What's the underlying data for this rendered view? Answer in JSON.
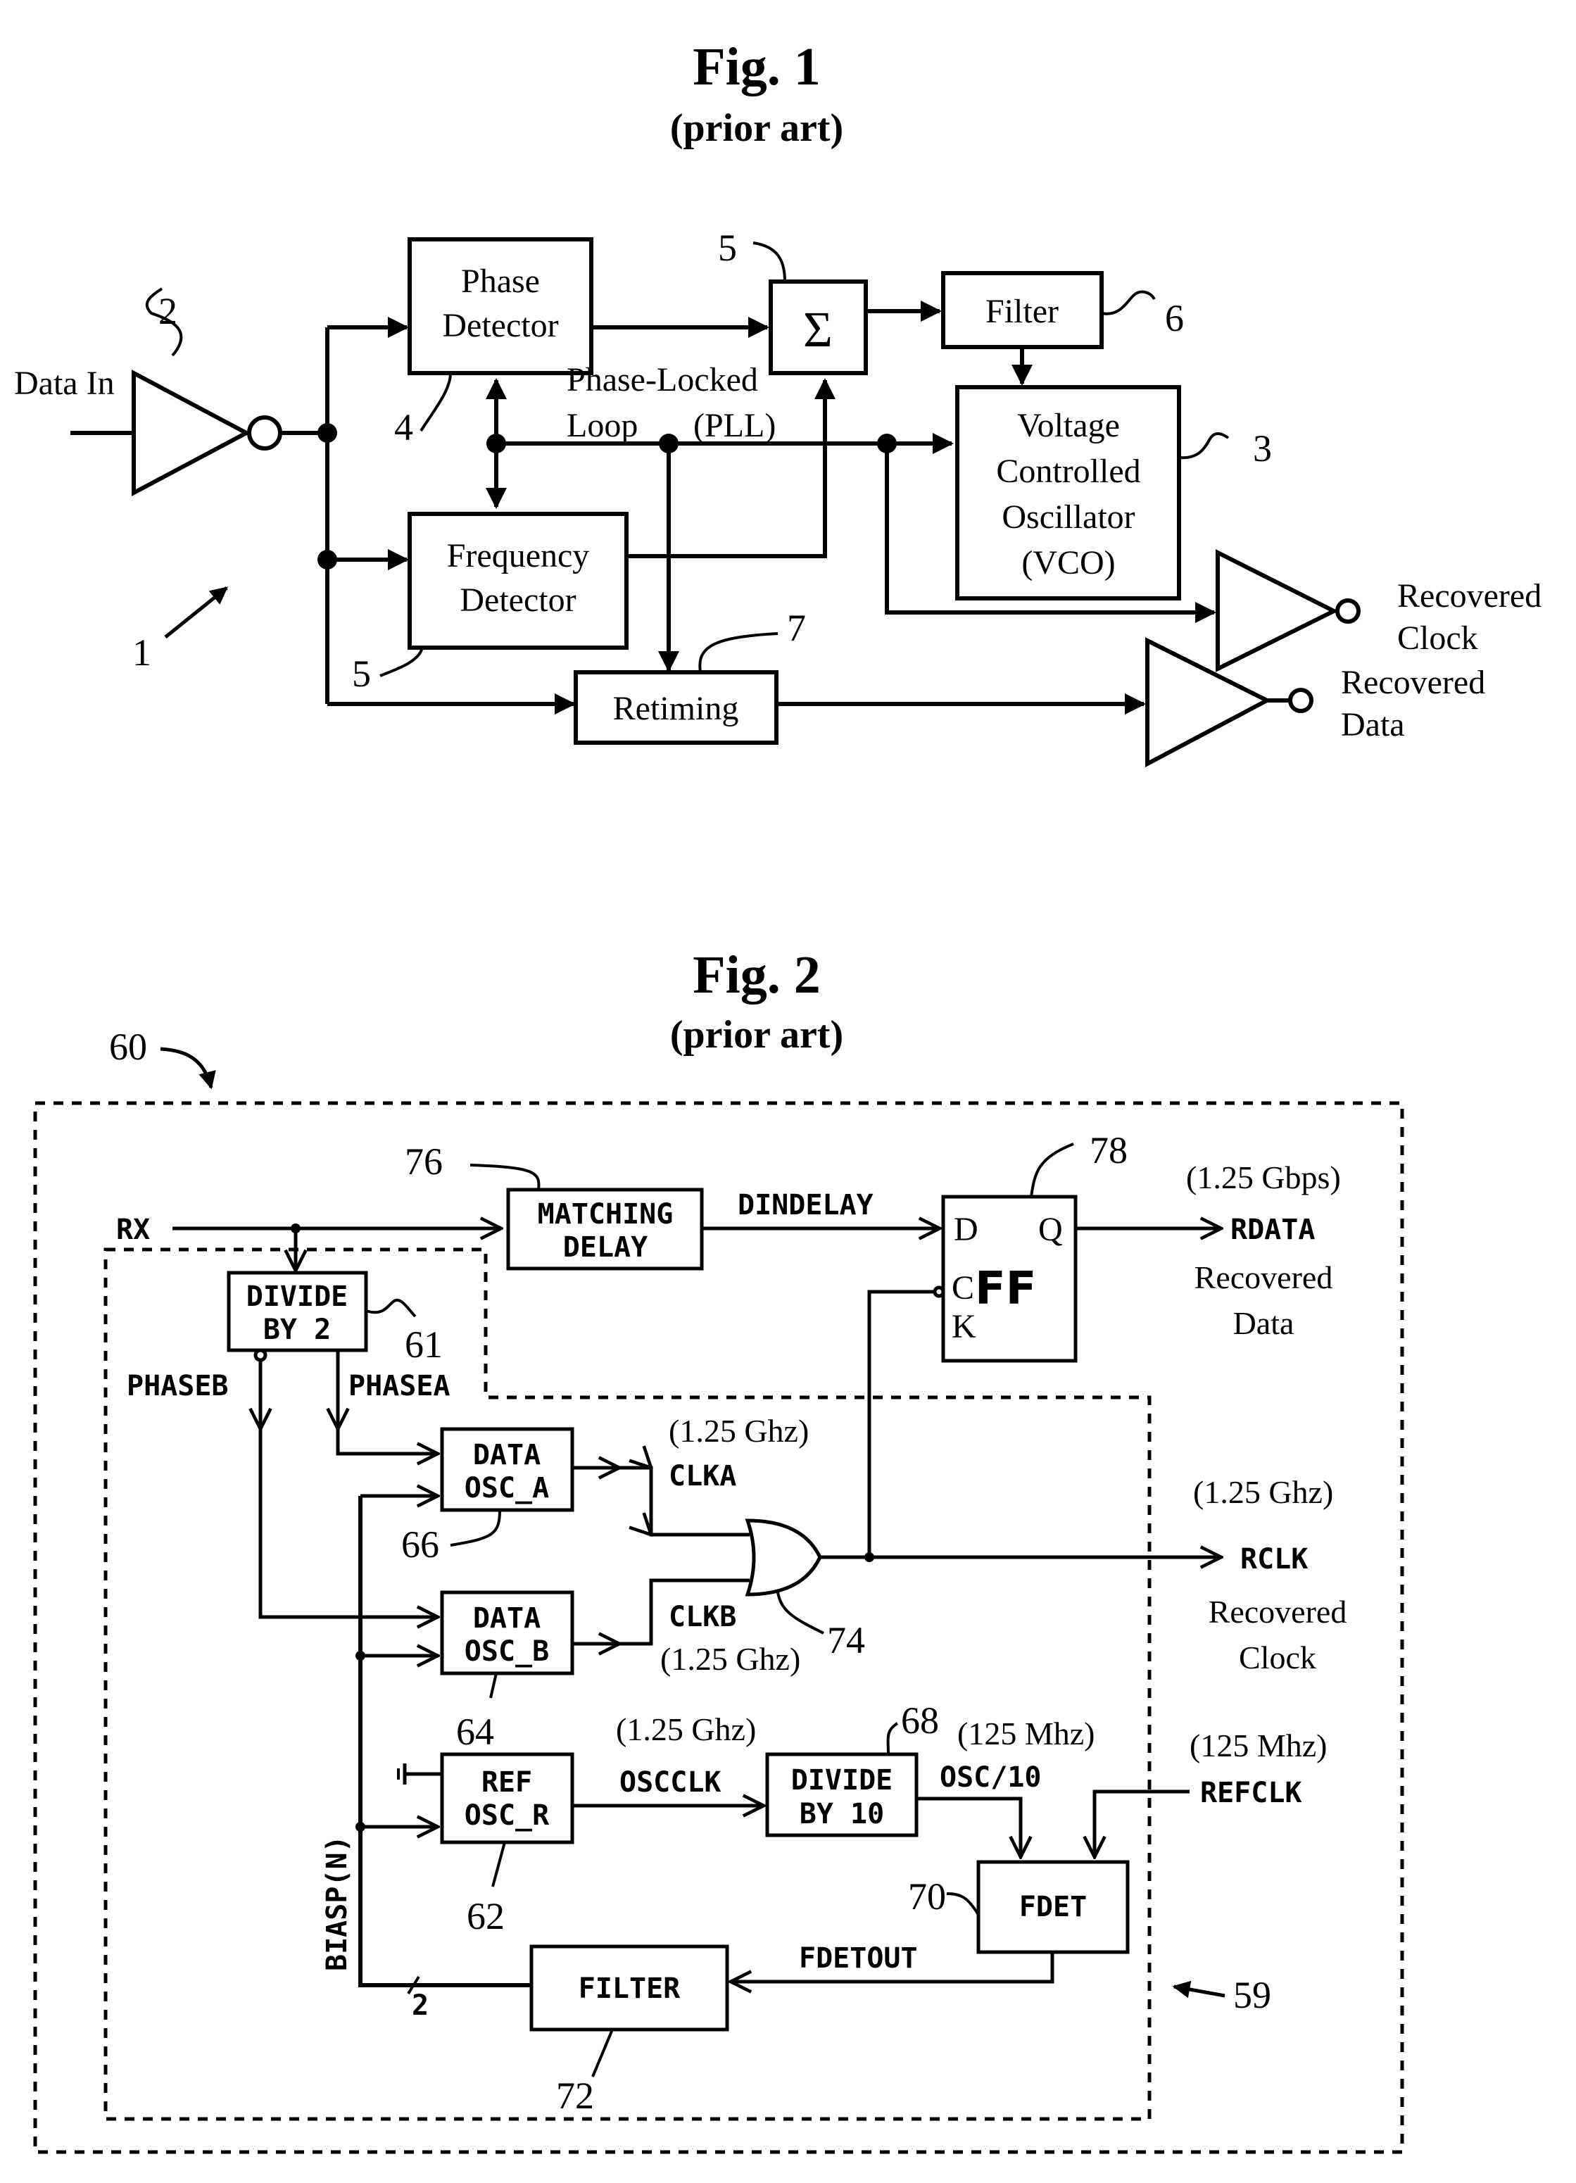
{
  "fig1": {
    "title": "Fig. 1",
    "subtitle": "(prior art)",
    "blocks": {
      "phase_detector": [
        "Phase",
        "Detector"
      ],
      "frequency_detector": [
        "Frequency",
        "Detector"
      ],
      "sum": "Σ",
      "filter": "Filter",
      "vco": [
        "Voltage",
        "Controlled",
        "Oscillator",
        "(VCO)"
      ],
      "retiming": "Retiming"
    },
    "labels": {
      "data_in": "Data In",
      "pll_line1": "Phase-Locked",
      "pll_line2a": "Loop",
      "pll_line2b": "(PLL)",
      "recovered_clock": [
        "Recovered",
        "Clock"
      ],
      "recovered_data": [
        "Recovered",
        "Data"
      ]
    },
    "refs": {
      "system": "1",
      "input_buffer": "2",
      "vco": "3",
      "phase_detector": "4",
      "sum": "5",
      "frequency_detector": "5",
      "filter": "6",
      "retiming": "7"
    }
  },
  "fig2": {
    "title": "Fig. 2",
    "subtitle": "(prior art)",
    "blocks": {
      "matching_delay": [
        "MATCHING",
        "DELAY"
      ],
      "divide_by_2": [
        "DIVIDE",
        "BY 2"
      ],
      "flip_flop": {
        "d": "D",
        "q": "Q",
        "c": "C",
        "k": "K",
        "name": "FF"
      },
      "data_osc_a": [
        "DATA",
        "OSC_A"
      ],
      "data_osc_b": [
        "DATA",
        "OSC_B"
      ],
      "ref_osc_r": [
        "REF",
        "OSC_R"
      ],
      "divide_by_10": [
        "DIVIDE",
        "BY 10"
      ],
      "fdet": "FDET",
      "filter": "FILTER"
    },
    "signals": {
      "rx": "RX",
      "dindelay": "DINDELAY",
      "rdata": "RDATA",
      "phaseb": "PHASEB",
      "phasea": "PHASEA",
      "clka": "CLKA",
      "clkb": "CLKB",
      "rclk": "RCLK",
      "oscclk": "OSCCLK",
      "osc10": "OSC/10",
      "refclk": "REFCLK",
      "fdetout": "FDETOUT",
      "biasp": "BIASP(N)",
      "bus_width": "2"
    },
    "rates": {
      "rdata": "(1.25 Gbps)",
      "clka": "(1.25 Ghz)",
      "clkb": "(1.25 Ghz)",
      "rclk": "(1.25 Ghz)",
      "oscclk": "(1.25 Ghz)",
      "osc10": "(125 Mhz)",
      "refclk": "(125 Mhz)"
    },
    "labels": {
      "recovered_data": [
        "Recovered",
        "Data"
      ],
      "recovered_clock": [
        "Recovered",
        "Clock"
      ]
    },
    "refs": {
      "outer": "60",
      "inner": "59",
      "divide_by_2": "61",
      "ref_osc": "62",
      "data_osc_b": "64",
      "data_osc_a": "66",
      "divide_by_10": "68",
      "fdet": "70",
      "filter": "72",
      "or_gate": "74",
      "matching_delay": "76",
      "flip_flop": "78"
    }
  }
}
